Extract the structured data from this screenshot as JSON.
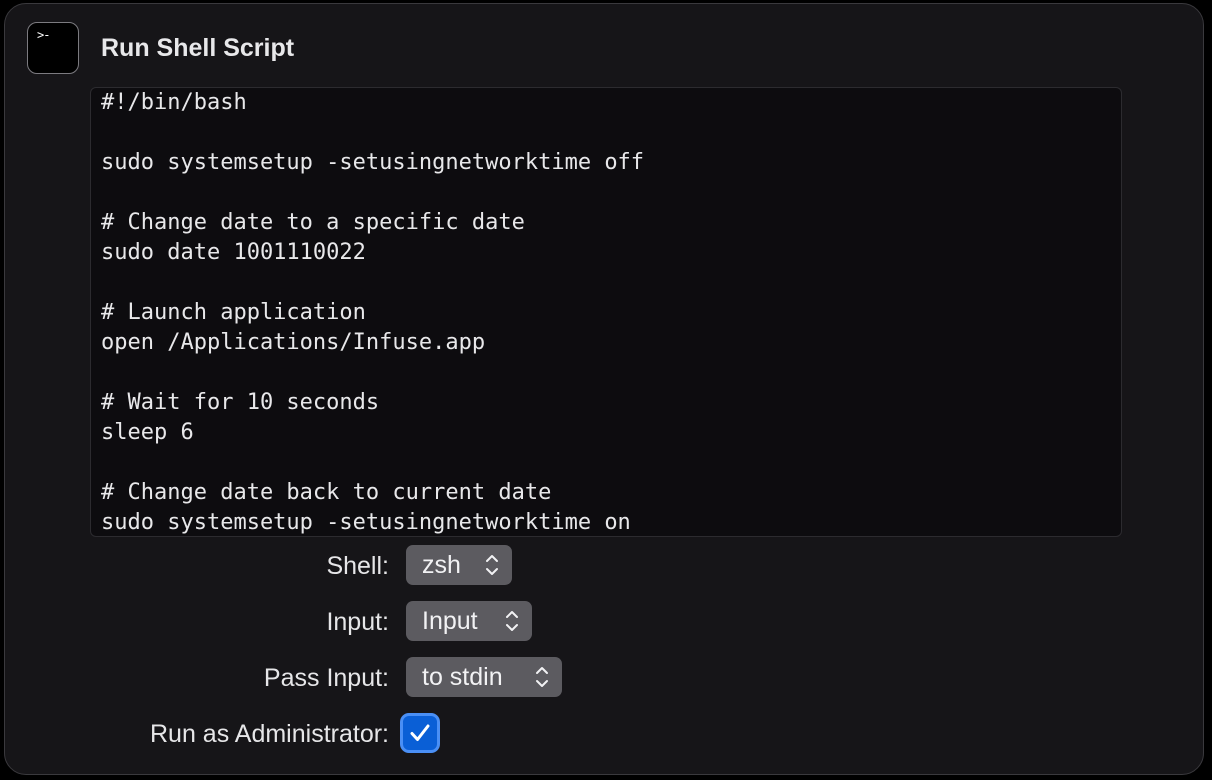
{
  "action": {
    "icon": "terminal-icon",
    "prompt_glyph": ">-",
    "title": "Run Shell Script"
  },
  "script": {
    "lines": [
      "#!/bin/bash",
      "",
      "sudo systemsetup -setusingnetworktime off",
      "",
      "# Change date to a specific date",
      "sudo date 1001110022",
      "",
      "# Launch application",
      "open /Applications/Infuse.app",
      "",
      "# Wait for 10 seconds",
      "sleep 6",
      "",
      "# Change date back to current date",
      "sudo systemsetup -setusingnetworktime on"
    ]
  },
  "options": {
    "shell": {
      "label": "Shell:",
      "value": "zsh"
    },
    "input": {
      "label": "Input:",
      "value": "Input"
    },
    "pass_input": {
      "label": "Pass Input:",
      "value": "to stdin"
    },
    "run_as_admin": {
      "label": "Run as Administrator:",
      "checked": true
    }
  },
  "colors": {
    "accent": "#0a5fd6",
    "card_background": "#161518",
    "popup_background": "#5c5b60"
  }
}
